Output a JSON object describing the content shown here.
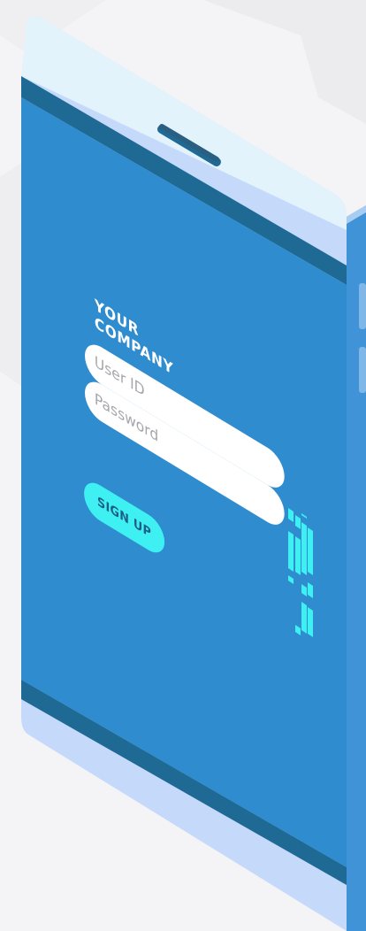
{
  "brand": {
    "name": "YOUR\nCOMPANY"
  },
  "form": {
    "user_placeholder": "User ID",
    "password_placeholder": "Password",
    "signup_label": "SIGN UP"
  },
  "colors": {
    "background": "#f4f4f6",
    "screen": "#2e8ccf",
    "screen_band": "#1e6a94",
    "frame_light": "#c9dcfb",
    "frame_top": "#e2f3fc",
    "accent": "#3ff0f2",
    "text_on_accent": "#1d5f86"
  },
  "icons": {
    "speaker": "speaker-slot-icon",
    "signal": "signal-bars-icon"
  }
}
